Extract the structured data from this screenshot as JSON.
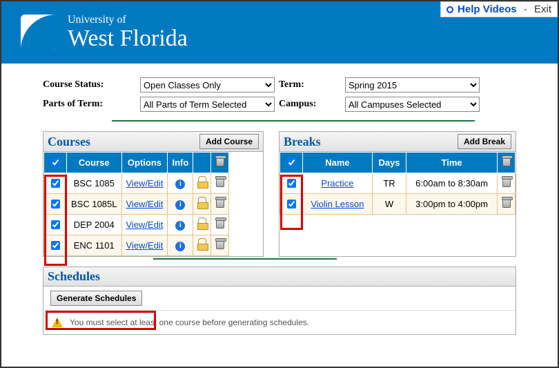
{
  "topbar": {
    "help": "Help Videos",
    "sep": "-",
    "exit": "Exit"
  },
  "brand": {
    "univ_of": "University of",
    "name": "West Florida"
  },
  "filters": {
    "course_status_label": "Course Status:",
    "course_status_value": "Open Classes Only",
    "parts_label": "Parts of Term:",
    "parts_value": "All Parts of Term Selected",
    "term_label": "Term:",
    "term_value": "Spring 2015",
    "campus_label": "Campus:",
    "campus_value": "All Campuses Selected"
  },
  "courses": {
    "title": "Courses",
    "add_label": "Add Course",
    "headers": {
      "course": "Course",
      "options": "Options",
      "info": "Info"
    },
    "rows": [
      {
        "checked": true,
        "course": "BSC 1085",
        "options": "View/Edit"
      },
      {
        "checked": true,
        "course": "BSC 1085L",
        "options": "View/Edit"
      },
      {
        "checked": true,
        "course": "DEP 2004",
        "options": "View/Edit"
      },
      {
        "checked": true,
        "course": "ENC 1101",
        "options": "View/Edit"
      }
    ]
  },
  "breaks": {
    "title": "Breaks",
    "add_label": "Add Break",
    "headers": {
      "name": "Name",
      "days": "Days",
      "time": "Time"
    },
    "rows": [
      {
        "checked": true,
        "name": "Practice",
        "days": "TR",
        "time": "6:00am to 8:30am"
      },
      {
        "checked": true,
        "name": "Violin Lesson",
        "days": "W",
        "time": "3:00pm to 4:00pm"
      }
    ]
  },
  "schedules": {
    "title": "Schedules",
    "generate_label": "Generate Schedules",
    "warning": "You must select at least one course before generating schedules."
  }
}
